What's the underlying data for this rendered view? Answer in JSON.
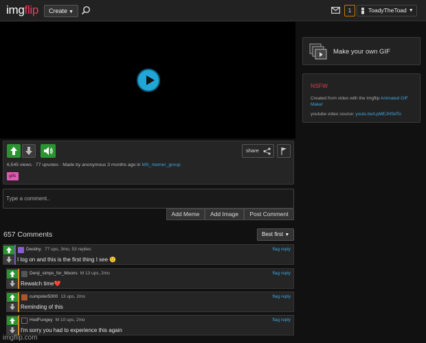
{
  "nav": {
    "logo_img": "img",
    "logo_flip": "flip",
    "create_label": "Create",
    "notification_count": "1",
    "username": "ToadyTheToad"
  },
  "sidebar": {
    "make_gif": "Make your own GIF",
    "nsfw": "NSFW",
    "created_prefix": "Created from video with the Imgflip",
    "created_link": "Animated GIF Maker",
    "source_label": "youtube video source:",
    "source_link": "youtu.be/LpMEJhf3dTo"
  },
  "post": {
    "share_label": "share",
    "meta_text": "6,545 views · 77 upvotes · Made by anonymous 3 months ago in",
    "stream_link": "MS_memer_group",
    "tag": "gifs"
  },
  "comment_box": {
    "placeholder": "Type a comment..",
    "add_meme": "Add Meme",
    "add_image": "Add Image",
    "post_comment": "Post Comment"
  },
  "comments_header": {
    "count": "657 Comments",
    "sort": "Best first"
  },
  "comments": [
    {
      "username": "Destiny.",
      "meta": "77 ups, 3mo, 53 replies",
      "text": "I log on and this is the first thing I see 😕",
      "actions": "flag reply"
    },
    {
      "username": "Denji_simps_for_Moons",
      "meta": "M   13 ups, 2mo",
      "text": "Rewatch time❤️",
      "actions": "flag reply"
    },
    {
      "username": "cumpster5000",
      "meta": "13 ups, 2mo",
      "text": "Reminding of this",
      "actions": "flag reply"
    },
    {
      "username": "HodFungey",
      "meta": "M   10 ups, 2mo",
      "text": "I'm sorry you had to experience this again",
      "actions": "flag reply"
    }
  ],
  "watermark": "imgflip.com",
  "colors": {
    "accent_green": "#2c9332",
    "link_blue": "#3fa7e0",
    "nsfw_red": "#e0384e",
    "play_blue": "#1fa7d8",
    "tag_pink": "#e25ab4"
  }
}
